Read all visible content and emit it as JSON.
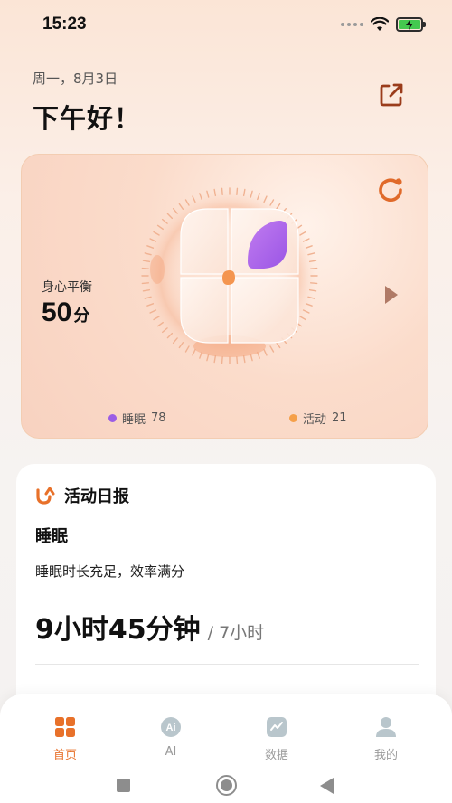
{
  "status_bar": {
    "time": "15:23",
    "icons": [
      "signal-dots",
      "wifi-icon",
      "battery-charging-icon"
    ]
  },
  "header": {
    "date": "周一，8月3日",
    "greeting": "下午好！",
    "share_icon": "share-icon"
  },
  "balance_card": {
    "label": "身心平衡",
    "score": "50",
    "score_unit": "分",
    "legend": [
      {
        "label": "睡眠",
        "value": "78",
        "color": "#9b5de5"
      },
      {
        "label": "活动",
        "value": "21",
        "color": "#f5a04a"
      }
    ],
    "accent_color": "#e8712a"
  },
  "activity_report": {
    "title": "活动日报",
    "section": "睡眠",
    "description": "睡眠时长充足，效率满分",
    "value": "9小时45分钟",
    "target": "/ 7小时"
  },
  "bottom_nav": {
    "items": [
      {
        "label": "首页",
        "icon": "home-grid-icon",
        "active": true
      },
      {
        "label": "AI",
        "icon": "ai-icon",
        "active": false
      },
      {
        "label": "数据",
        "icon": "data-chart-icon",
        "active": false
      },
      {
        "label": "我的",
        "icon": "profile-icon",
        "active": false
      }
    ]
  }
}
